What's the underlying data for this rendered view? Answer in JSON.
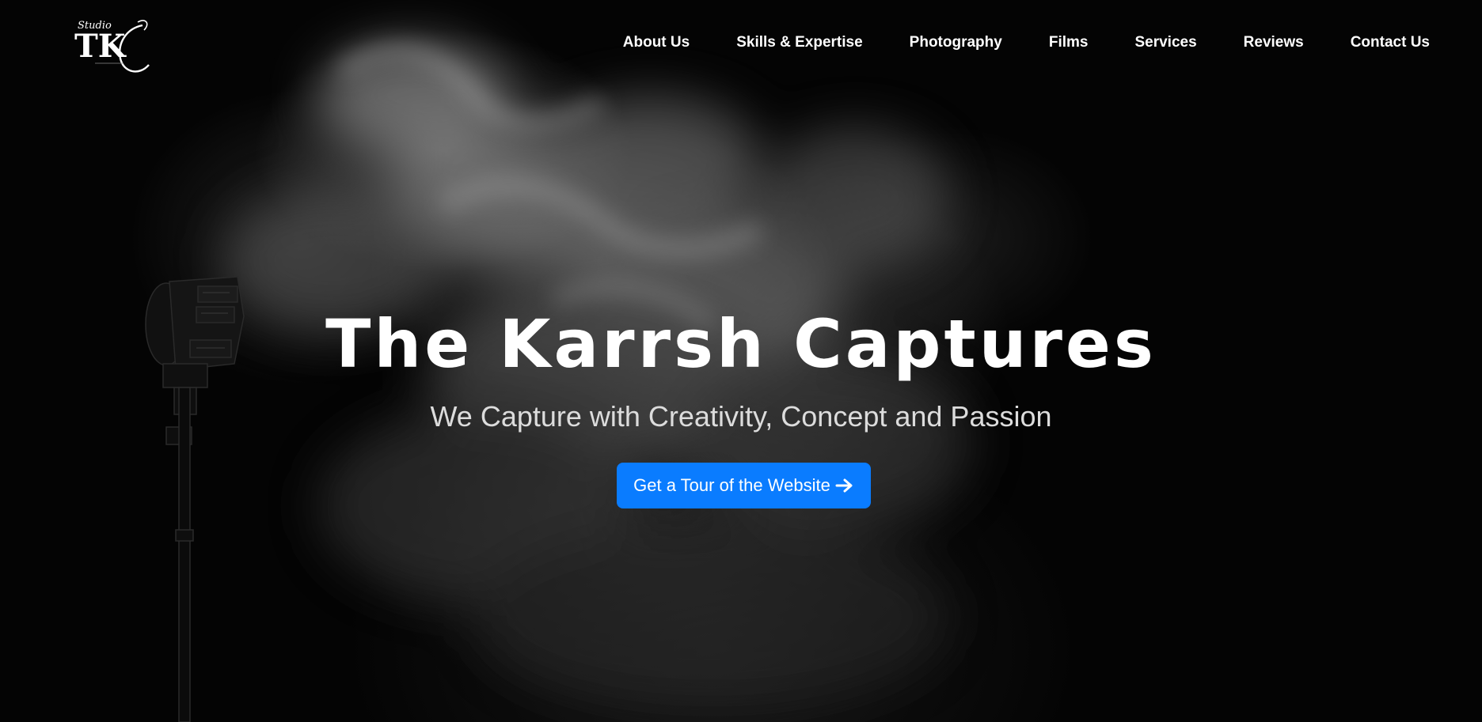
{
  "logo": {
    "name": "logo",
    "text_top": "Studio",
    "text_main": "TKC"
  },
  "nav": {
    "items": [
      {
        "label": "About Us"
      },
      {
        "label": "Skills & Expertise"
      },
      {
        "label": "Photography"
      },
      {
        "label": "Films"
      },
      {
        "label": "Services"
      },
      {
        "label": "Reviews"
      },
      {
        "label": "Contact Us"
      }
    ]
  },
  "hero": {
    "title": "The Karrsh Captures",
    "subtitle": "We Capture with Creativity, Concept and Passion",
    "cta_label": "Get a Tour of the Website",
    "cta_icon": "arrow-right-icon"
  },
  "colors": {
    "accent": "#0a7cff",
    "background": "#040404",
    "text": "#ffffff"
  }
}
